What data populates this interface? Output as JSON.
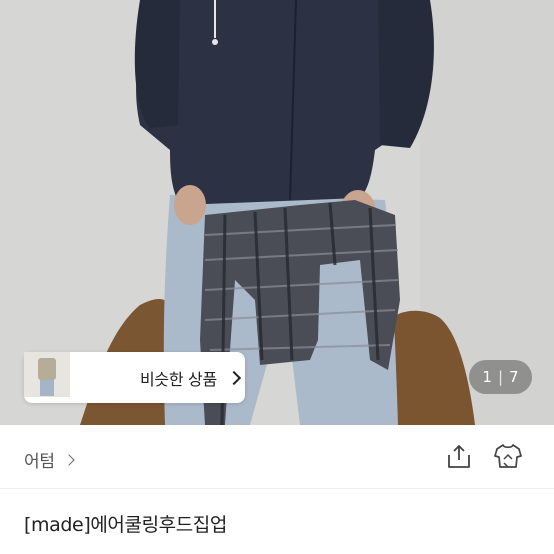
{
  "product_image": {
    "alt_icon": "product-photo"
  },
  "similar_products": {
    "label": "비슷한 상품",
    "chevron_icon": "chevron-right-icon"
  },
  "pagination": {
    "current": "1",
    "total": "7"
  },
  "store": {
    "name": "어텀",
    "chevron_icon": "chevron-right-icon"
  },
  "actions": {
    "share_icon": "share-icon",
    "compare_icon": "clothing-compare-icon"
  },
  "product": {
    "title": "[made]에어쿨링후드집업"
  },
  "colors": {
    "hoodie": "#2b3142",
    "jeans": "#a9b8c8",
    "chair": "#7a5632",
    "background": "#d6d6d4"
  }
}
